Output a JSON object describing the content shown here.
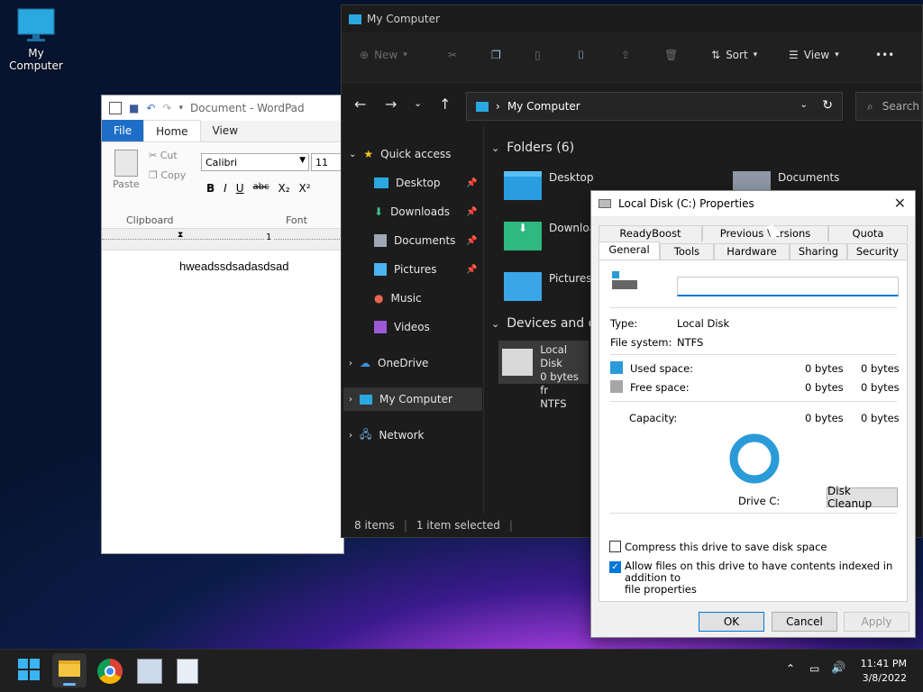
{
  "desktop": {
    "icon_label": "My Computer"
  },
  "wordpad": {
    "title": "Document - WordPad",
    "tabs": [
      "File",
      "Home",
      "View"
    ],
    "paste_label": "Paste",
    "cut_label": "Cut",
    "copy_label": "Copy",
    "clipboard_group": "Clipboard",
    "font_group": "Font",
    "font_name": "Calibri",
    "font_size": "11",
    "ruler_mark": "1",
    "format_buttons": [
      "B",
      "I",
      "U",
      "abc",
      "X₂",
      "X²"
    ],
    "document_text": "hweadssdsadasdsad"
  },
  "explorer": {
    "title": "My Computer",
    "toolbar": {
      "new": "New",
      "sort": "Sort",
      "view": "View",
      "more": "•••"
    },
    "address": "My Computer",
    "search_placeholder": "Search",
    "sidebar": {
      "quick_access": "Quick access",
      "items": [
        "Desktop",
        "Downloads",
        "Documents",
        "Pictures",
        "Music",
        "Videos"
      ],
      "onedrive": "OneDrive",
      "my_computer": "My Computer",
      "network": "Network"
    },
    "folders_header": "Folders (6)",
    "folders": [
      "Desktop",
      "Downloa",
      "Pictures",
      "Documents"
    ],
    "devices_header": "Devices and dr",
    "drive": {
      "name": "Local Disk",
      "space": "0 bytes fr",
      "fs": "NTFS"
    },
    "status": {
      "items": "8 items",
      "selected": "1 item selected"
    }
  },
  "properties": {
    "title": "Local Disk (C:) Properties",
    "tabs_top": [
      "ReadyBoost",
      "Previous Versions",
      "Quota"
    ],
    "tabs_bottom": [
      "General",
      "Tools",
      "Hardware",
      "Sharing",
      "Security"
    ],
    "name_value": "",
    "type_label": "Type:",
    "type_value": "Local Disk",
    "fs_label": "File system:",
    "fs_value": "NTFS",
    "used_label": "Used space:",
    "used_bytes": "0 bytes",
    "used_bytes2": "0 bytes",
    "free_label": "Free space:",
    "free_bytes": "0 bytes",
    "free_bytes2": "0 bytes",
    "capacity_label": "Capacity:",
    "capacity_bytes": "0 bytes",
    "capacity_bytes2": "0 bytes",
    "drive_label": "Drive C:",
    "cleanup_button": "Disk Cleanup",
    "compress_label": "Compress this drive to save disk space",
    "index_label_1": "Allow files on this drive to have contents indexed in addition to",
    "index_label_2": "file properties",
    "ok": "OK",
    "cancel": "Cancel",
    "apply": "Apply",
    "colors": {
      "used": "#2b9ad8",
      "free": "#a6a6a6",
      "accent": "#0078d7"
    }
  },
  "taskbar": {
    "time": "11:41 PM",
    "date": "3/8/2022"
  }
}
